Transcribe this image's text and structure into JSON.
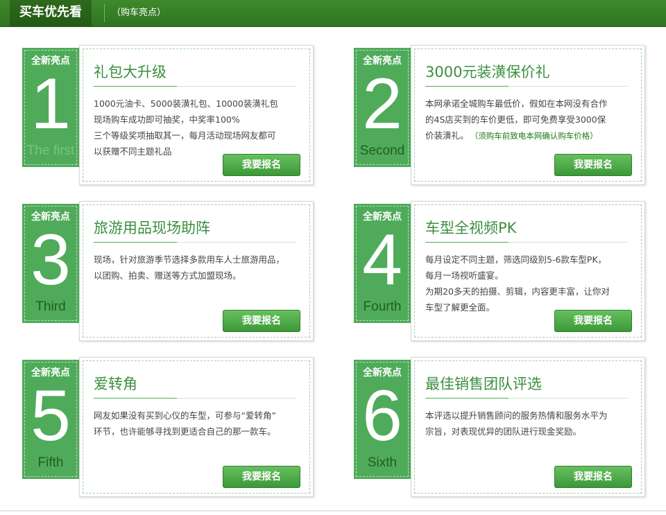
{
  "header": {
    "title": "买车优先看",
    "subtitle": "（购车亮点）"
  },
  "cards": [
    {
      "tag_label": "全新亮点",
      "number": "1",
      "number_word": "The first",
      "title": "礼包大升级",
      "lines": [
        "1000元油卡、5000装潢礼包、10000装潢礼包",
        "现场购车成功即可抽奖，中奖率100%",
        "三个等级奖项抽取其一，每月活动现场网友都可",
        "以获赠不同主题礼品"
      ],
      "button": "我要报名"
    },
    {
      "tag_label": "全新亮点",
      "number": "2",
      "number_word": "Second",
      "title": "3000元装潢保价礼",
      "lines": [
        "本网承诺全城购车最低价，假如在本网没有合作",
        "的4S店买到的车价更低，即可免费享受3000保",
        "价装潢礼。"
      ],
      "note": "（须购车前致电本网确认购车价格）",
      "button": "我要报名"
    },
    {
      "tag_label": "全新亮点",
      "number": "3",
      "number_word": "Third",
      "title": "旅游用品现场助阵",
      "lines": [
        "现场，针对旅游季节选择多款用车人士旅游用品，",
        "以团购、拍卖、赠送等方式加盟现场。"
      ],
      "button": "我要报名"
    },
    {
      "tag_label": "全新亮点",
      "number": "4",
      "number_word": "Fourth",
      "title": "车型全视频PK",
      "lines": [
        "每月设定不同主题，筛选同级别5-6款车型PK，",
        "每月一场视听盛宴。",
        "为期20多天的拍摄、剪辑，内容更丰富，让你对",
        "车型了解更全面。"
      ],
      "button": "我要报名"
    },
    {
      "tag_label": "全新亮点",
      "number": "5",
      "number_word": "Fifth",
      "title": "爱转角",
      "lines": [
        "网友如果没有买到心仪的车型，可参与“爱转角”",
        "环节，也许能够寻找到更适合自己的那一款车。"
      ],
      "button": "我要报名"
    },
    {
      "tag_label": "全新亮点",
      "number": "6",
      "number_word": "Sixth",
      "title": "最佳销售团队评选",
      "lines": [
        "本评选以提升销售顾问的服务热情和服务水平为",
        "宗旨，对表现优异的团队进行现金奖励。"
      ],
      "button": "我要报名"
    }
  ]
}
